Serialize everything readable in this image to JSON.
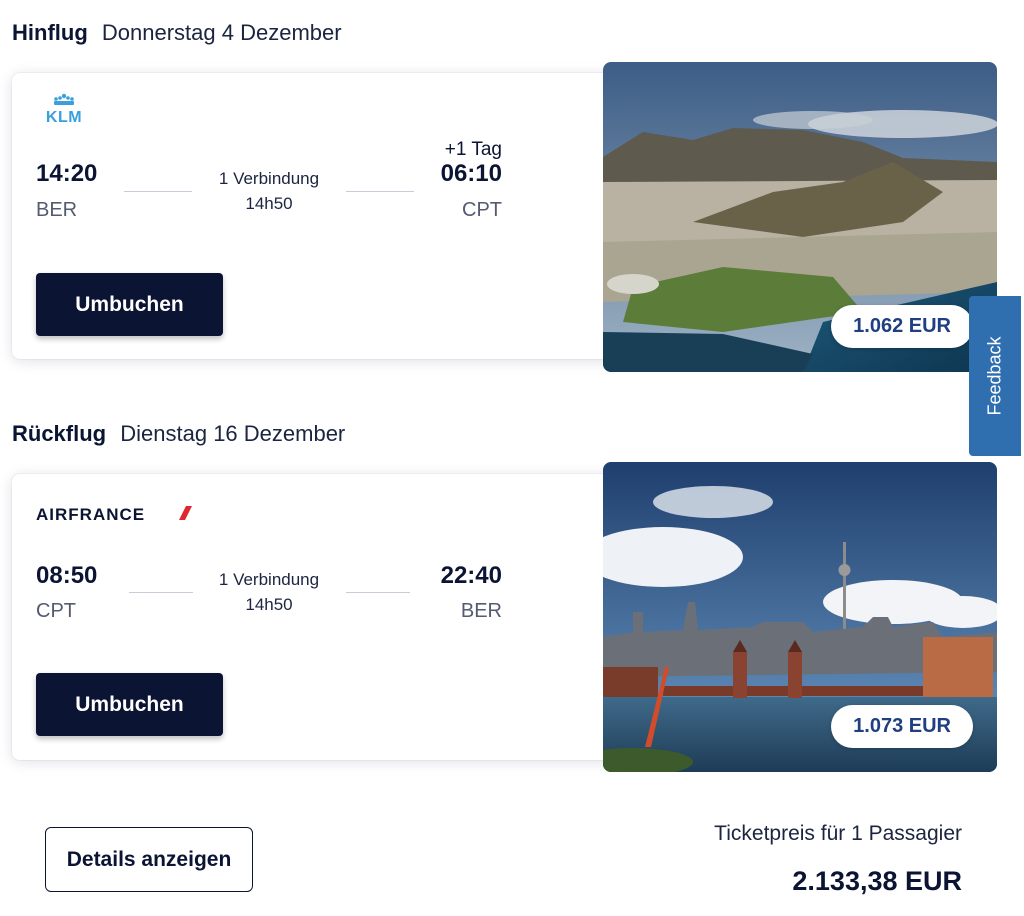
{
  "outbound": {
    "heading": "Hinflug",
    "date": "Donnerstag 4 Dezember",
    "airline": "KLM",
    "departure_time": "14:20",
    "departure_code": "BER",
    "arrival_time": "06:10",
    "arrival_code": "CPT",
    "next_day": "+1 Tag",
    "connections": "1 Verbindung",
    "duration": "14h50",
    "rebook_label": "Umbuchen",
    "price": "1.062 EUR",
    "destination_image": "cape-town-photo"
  },
  "return": {
    "heading": "Rückflug",
    "date": "Dienstag 16 Dezember",
    "airline": "AIRFRANCE",
    "departure_time": "08:50",
    "departure_code": "CPT",
    "arrival_time": "22:40",
    "arrival_code": "BER",
    "connections": "1 Verbindung",
    "duration": "14h50",
    "rebook_label": "Umbuchen",
    "price": "1.073 EUR",
    "destination_image": "berlin-photo"
  },
  "feedback_label": "Feedback",
  "footer": {
    "details_label": "Details anzeigen",
    "ticket_label": "Ticketpreis für 1 Passagier",
    "total": "2.133,38 EUR"
  },
  "colors": {
    "navy": "#0b1433",
    "price_blue": "#1f3f82",
    "feedback_blue": "#2f6fb0",
    "klm_blue": "#3aa0dc",
    "airfrance_red": "#e0262e"
  }
}
